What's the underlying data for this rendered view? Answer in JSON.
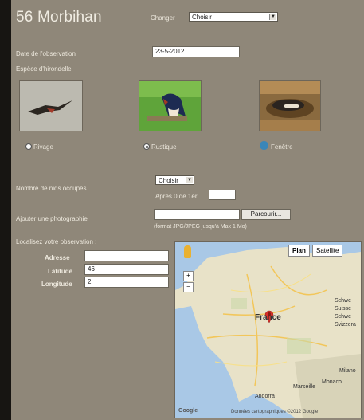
{
  "header": {
    "title": "56 Morbihan",
    "change_label": "Changer",
    "change_select_value": "Choisir"
  },
  "form": {
    "date_label": "Date de l'observation",
    "date_value": "23-5-2012",
    "species_label": "Espèce d'hirondelle",
    "species": [
      {
        "label": "Rivage",
        "checked": false
      },
      {
        "label": "Rustique",
        "checked": true
      },
      {
        "label": "Fenêtre",
        "checked": false
      }
    ],
    "count_label": "Nombre de nids occupés",
    "count_select_value": "Choisir",
    "count_extra_label": "Après 0 de 1er",
    "photo_label": "Ajouter une photographie",
    "browse_button": "Parcourir...",
    "format_hint": "(format JPG/JPEG jusqu'à Max 1 Mo)",
    "location_label": "Localisez votre observation :",
    "address_label": "Adresse",
    "address_value": "",
    "latitude_label": "Latitude",
    "latitude_value": "46",
    "longitude_label": "Longitude",
    "longitude_value": "2"
  },
  "map": {
    "plan_button": "Plan",
    "satellite_button": "Satellite",
    "labels": {
      "center": "France",
      "east1": "Schwe",
      "east2": "Suisse",
      "east3": "Schwe",
      "east4": "Svizzera",
      "east5": "Milano",
      "south1": "Andorra",
      "south2": "Marseille",
      "south3": "Monaco"
    },
    "footer": "Données cartographiques ©2012 Google",
    "google": "Google"
  },
  "colors": {
    "page_bg": "#8f8779",
    "strip": "#171512",
    "text": "#ede8dd",
    "map_land": "#e8e2c8",
    "map_sea": "#a9c8e6",
    "marker": "#d9302a"
  }
}
